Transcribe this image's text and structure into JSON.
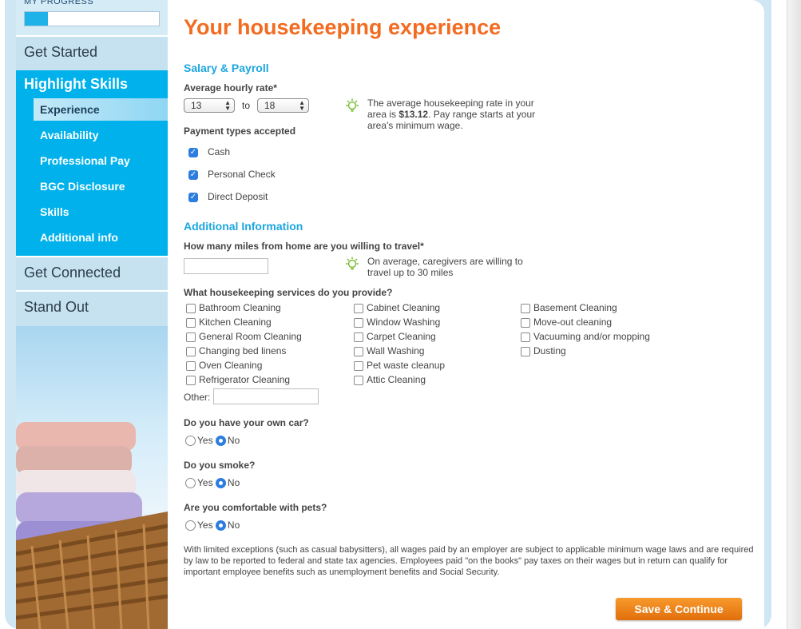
{
  "sidebar": {
    "progress_label": "MY PROGRESS",
    "progress_percent": 17,
    "sections": [
      {
        "label": "Get Started"
      },
      {
        "label": "Highlight Skills"
      },
      {
        "label": "Get Connected"
      },
      {
        "label": "Stand Out"
      }
    ],
    "subitems": [
      "Experience",
      "Availability",
      "Professional Pay",
      "BGC Disclosure",
      "Skills",
      "Additional info"
    ]
  },
  "main": {
    "title": "Your housekeeping experience",
    "salary": {
      "heading": "Salary & Payroll",
      "rate_label": "Average hourly rate*",
      "rate_from": "13",
      "rate_to_label": "to",
      "rate_to": "18",
      "tip_prefix": "The average housekeeping rate in your area is ",
      "tip_rate": "$13.12",
      "tip_suffix": ". Pay range starts at your area's minimum wage.",
      "payment_label": "Payment types accepted",
      "payment_types": [
        "Cash",
        "Personal Check",
        "Direct Deposit"
      ]
    },
    "additional": {
      "heading": "Additional Information",
      "miles_label": "How many miles from home are you willing to travel*",
      "miles_value": "",
      "miles_tip": "On average, caregivers are willing to travel up to 30 miles",
      "services_label": "What housekeeping services do you provide?",
      "services_col1": [
        "Bathroom Cleaning",
        "Kitchen Cleaning",
        "General Room Cleaning",
        "Changing bed linens",
        "Oven Cleaning",
        "Refrigerator Cleaning"
      ],
      "services_col2": [
        "Cabinet Cleaning",
        "Window Washing",
        "Carpet Cleaning",
        "Wall Washing",
        "Pet waste cleanup",
        "Attic Cleaning"
      ],
      "services_col3": [
        "Basement Cleaning",
        "Move-out cleaning",
        "Vacuuming and/or mopping",
        "Dusting"
      ],
      "other_label": "Other:",
      "other_value": ""
    },
    "questions": [
      {
        "label": "Do you have your own car?",
        "yes": "Yes",
        "no": "No",
        "selected": "No"
      },
      {
        "label": "Do you smoke?",
        "yes": "Yes",
        "no": "No",
        "selected": "No"
      },
      {
        "label": "Are you comfortable with pets?",
        "yes": "Yes",
        "no": "No",
        "selected": "No"
      }
    ],
    "disclaimer": "With limited exceptions (such as casual babysitters), all wages paid by an employer are subject to applicable minimum wage laws and are required by law to be reported to federal and state tax agencies. Employees paid \"on the books\" pay taxes on their wages but in return can qualify for important employee benefits such as unemployment benefits and Social Security.",
    "save_label": "Save & Continue"
  },
  "colors": {
    "accent_orange": "#f36b21",
    "heading_blue": "#1ba6df",
    "nav_active": "#00b1eb",
    "checkbox_blue": "#2d7de0"
  }
}
